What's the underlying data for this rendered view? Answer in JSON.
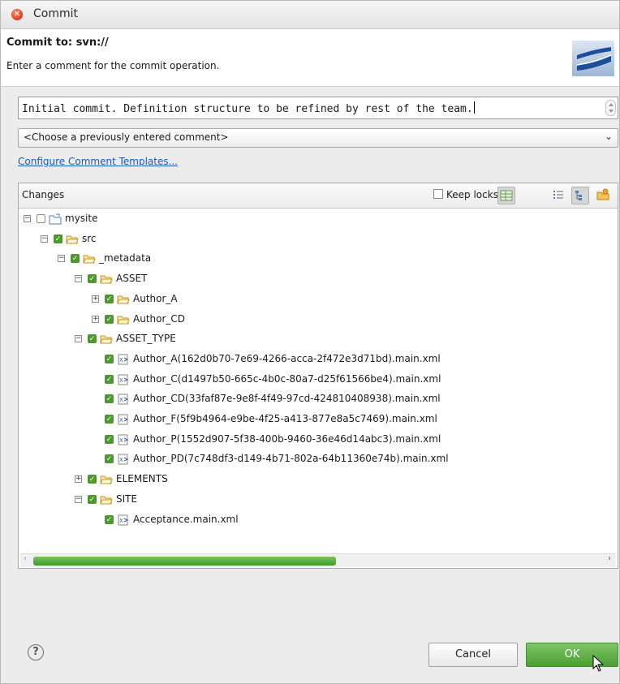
{
  "window": {
    "title": "Commit"
  },
  "header": {
    "title": "Commit to: svn://",
    "description": "Enter a comment for the commit operation."
  },
  "comment": {
    "value": "Initial commit. Definition structure to be refined by rest of the team."
  },
  "previous_comment": {
    "selected": "<Choose a previously entered comment>"
  },
  "templates_link": "Configure Comment Templates...",
  "changes": {
    "label": "Changes",
    "keep_locks_label": "Keep locks",
    "keep_locks_checked": false,
    "tree": [
      {
        "label": "mysite",
        "depth": 0,
        "expander": "minus",
        "checked": false,
        "icon": "project-folder-icon"
      },
      {
        "label": "src",
        "depth": 1,
        "expander": "minus",
        "checked": true,
        "icon": "folder-icon"
      },
      {
        "label": "_metadata",
        "depth": 2,
        "expander": "minus",
        "checked": true,
        "icon": "folder-icon"
      },
      {
        "label": "ASSET",
        "depth": 3,
        "expander": "minus",
        "checked": true,
        "icon": "folder-icon"
      },
      {
        "label": "Author_A",
        "depth": 4,
        "expander": "plus",
        "checked": true,
        "icon": "folder-icon"
      },
      {
        "label": "Author_CD",
        "depth": 4,
        "expander": "plus",
        "checked": true,
        "icon": "folder-icon"
      },
      {
        "label": "ASSET_TYPE",
        "depth": 3,
        "expander": "minus",
        "checked": true,
        "icon": "folder-icon"
      },
      {
        "label": "Author_A(162d0b70-7e69-4266-acca-2f472e3d71bd).main.xml",
        "depth": 4,
        "expander": "none",
        "checked": true,
        "icon": "xml-file-icon"
      },
      {
        "label": "Author_C(d1497b50-665c-4b0c-80a7-d25f61566be4).main.xml",
        "depth": 4,
        "expander": "none",
        "checked": true,
        "icon": "xml-file-icon"
      },
      {
        "label": "Author_CD(33faf87e-9e8f-4f49-97cd-424810408938).main.xml",
        "depth": 4,
        "expander": "none",
        "checked": true,
        "icon": "xml-file-icon"
      },
      {
        "label": "Author_F(5f9b4964-e9be-4f25-a413-877e8a5c7469).main.xml",
        "depth": 4,
        "expander": "none",
        "checked": true,
        "icon": "xml-file-icon"
      },
      {
        "label": "Author_P(1552d907-5f38-400b-9460-36e46d14abc3).main.xml",
        "depth": 4,
        "expander": "none",
        "checked": true,
        "icon": "xml-file-icon"
      },
      {
        "label": "Author_PD(7c748df3-d149-4b71-802a-64b11360e74b).main.xml",
        "depth": 4,
        "expander": "none",
        "checked": true,
        "icon": "xml-file-icon"
      },
      {
        "label": "ELEMENTS",
        "depth": 3,
        "expander": "plus",
        "checked": true,
        "icon": "folder-icon"
      },
      {
        "label": "SITE",
        "depth": 3,
        "expander": "minus",
        "checked": true,
        "icon": "folder-icon"
      },
      {
        "label": "Acceptance.main.xml",
        "depth": 4,
        "expander": "none",
        "checked": true,
        "icon": "xml-file-icon"
      }
    ],
    "horizontal_scroll_position": 0.5
  },
  "buttons": {
    "cancel": "Cancel",
    "ok": "OK"
  },
  "colors": {
    "accent_green": "#4c9f33",
    "link_blue": "#1d58b3"
  }
}
